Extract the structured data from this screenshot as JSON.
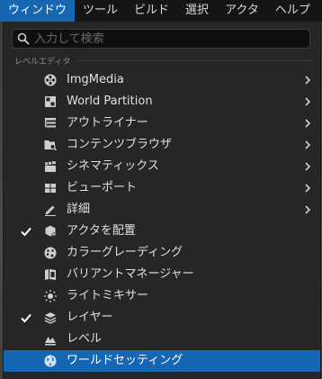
{
  "menubar": {
    "items": [
      {
        "label": "ウィンドウ",
        "active": true
      },
      {
        "label": "ツール"
      },
      {
        "label": "ビルド"
      },
      {
        "label": "選択"
      },
      {
        "label": "アクタ"
      },
      {
        "label": "ヘルプ"
      }
    ]
  },
  "search": {
    "placeholder": "入力して検索",
    "value": ""
  },
  "section": {
    "label": "レベルエディタ"
  },
  "menu_items": [
    {
      "label": "ImgMedia",
      "icon": "film-reel-icon",
      "submenu": true,
      "checked": false
    },
    {
      "label": "World Partition",
      "icon": "world-partition-icon",
      "submenu": true,
      "checked": false
    },
    {
      "label": "アウトライナー",
      "icon": "outliner-icon",
      "submenu": true,
      "checked": false
    },
    {
      "label": "コンテンツブラウザ",
      "icon": "content-browser-icon",
      "submenu": true,
      "checked": false
    },
    {
      "label": "シネマティックス",
      "icon": "clapperboard-icon",
      "submenu": true,
      "checked": false
    },
    {
      "label": "ビューポート",
      "icon": "viewport-grid-icon",
      "submenu": true,
      "checked": false
    },
    {
      "label": "詳細",
      "icon": "details-pencil-icon",
      "submenu": true,
      "checked": false
    },
    {
      "label": "アクタを配置",
      "icon": "place-actors-icon",
      "submenu": false,
      "checked": true
    },
    {
      "label": "カラーグレーディング",
      "icon": "color-grading-icon",
      "submenu": false,
      "checked": false
    },
    {
      "label": "バリアントマネージャー",
      "icon": "variant-manager-icon",
      "submenu": false,
      "checked": false
    },
    {
      "label": "ライトミキサー",
      "icon": "light-mixer-icon",
      "submenu": false,
      "checked": false
    },
    {
      "label": "レイヤー",
      "icon": "layers-icon",
      "submenu": false,
      "checked": true
    },
    {
      "label": "レベル",
      "icon": "levels-icon",
      "submenu": false,
      "checked": false
    },
    {
      "label": "ワールドセッティング",
      "icon": "globe-icon",
      "submenu": false,
      "checked": false,
      "highlighted": true
    }
  ],
  "colors": {
    "accent": "#1667b3",
    "menu_bg": "#262626",
    "text": "#e0e0e0",
    "menubar_bg": "#151515"
  }
}
